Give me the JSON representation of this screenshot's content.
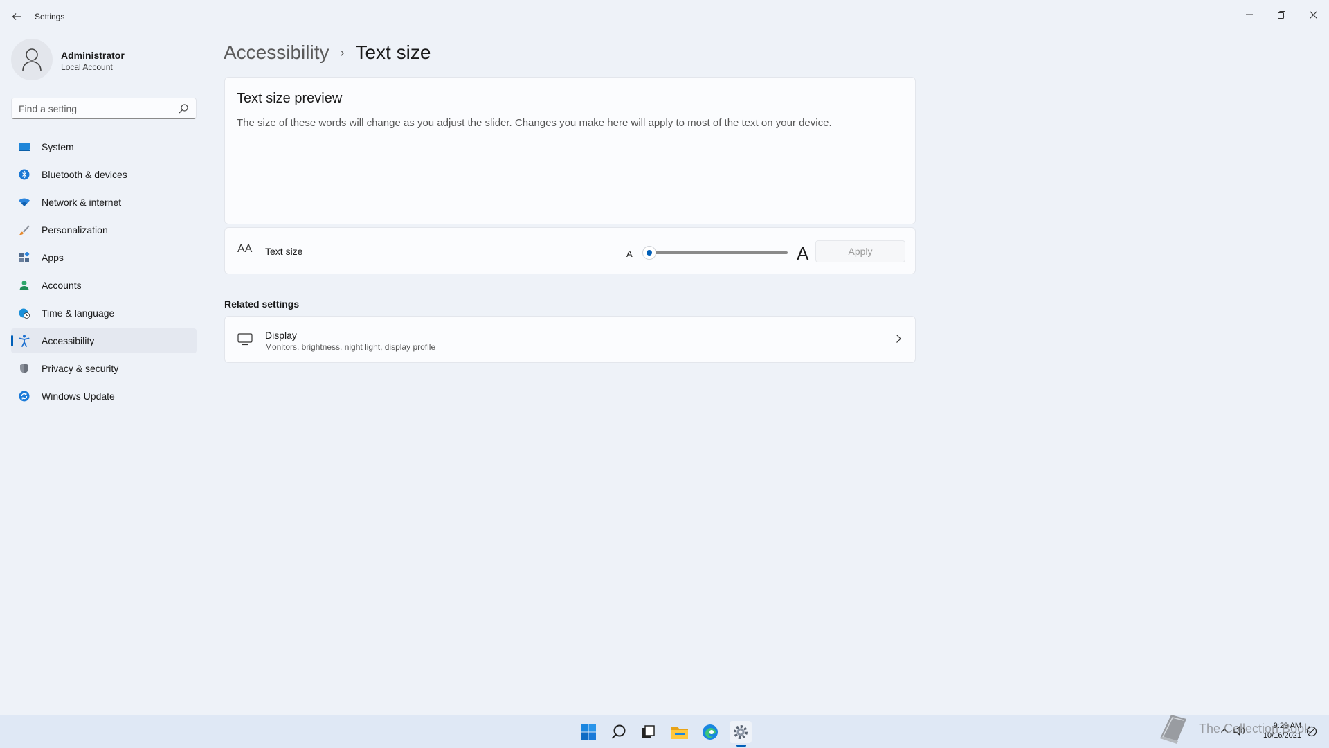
{
  "window": {
    "title": "Settings",
    "controls": [
      "minimize-icon",
      "restore-icon",
      "close-icon"
    ]
  },
  "profile": {
    "name": "Administrator",
    "account_type": "Local Account"
  },
  "search": {
    "placeholder": "Find a setting"
  },
  "sidebar": {
    "items": [
      {
        "label": "System",
        "icon": "system-icon",
        "color": "#0078d4"
      },
      {
        "label": "Bluetooth & devices",
        "icon": "bluetooth-icon",
        "color": "#0078d4"
      },
      {
        "label": "Network & internet",
        "icon": "wifi-icon",
        "color": "#2b7fd6"
      },
      {
        "label": "Personalization",
        "icon": "brush-icon",
        "color": "#e08a3c"
      },
      {
        "label": "Apps",
        "icon": "apps-icon",
        "color": "#5a6c85"
      },
      {
        "label": "Accounts",
        "icon": "person-icon",
        "color": "#2ea76b"
      },
      {
        "label": "Time & language",
        "icon": "globe-clock-icon",
        "color": "#1a8fd8"
      },
      {
        "label": "Accessibility",
        "icon": "accessibility-icon",
        "color": "#1a6fd0",
        "active": true
      },
      {
        "label": "Privacy & security",
        "icon": "shield-icon",
        "color": "#777f8c"
      },
      {
        "label": "Windows Update",
        "icon": "update-icon",
        "color": "#1a7ad8"
      }
    ]
  },
  "breadcrumb": {
    "parent": "Accessibility",
    "separator": "›",
    "current": "Text size"
  },
  "preview": {
    "title": "Text size preview",
    "text": "The size of these words will change as you adjust the slider. Changes you make here will apply to most of the text on your device."
  },
  "text_size": {
    "icon_text": "AA",
    "label": "Text size",
    "small_marker": "A",
    "large_marker": "A",
    "slider_value_percent": 100,
    "slider_min_percent": 100,
    "slider_max_percent": 225,
    "apply_label": "Apply"
  },
  "related": {
    "heading": "Related settings",
    "display": {
      "title": "Display",
      "subtitle": "Monitors, brightness, night light, display profile"
    }
  },
  "taskbar": {
    "apps": [
      "start-icon",
      "search-icon",
      "task-view-icon",
      "file-explorer-icon",
      "edge-icon",
      "settings-icon"
    ],
    "active_app": "settings-icon",
    "time": "9:29 AM",
    "date": "10/16/2021",
    "watermark": "The Collection Book"
  },
  "colors": {
    "accent": "#005fb8",
    "background": "#eef2f8",
    "card": "#fbfcfe"
  }
}
